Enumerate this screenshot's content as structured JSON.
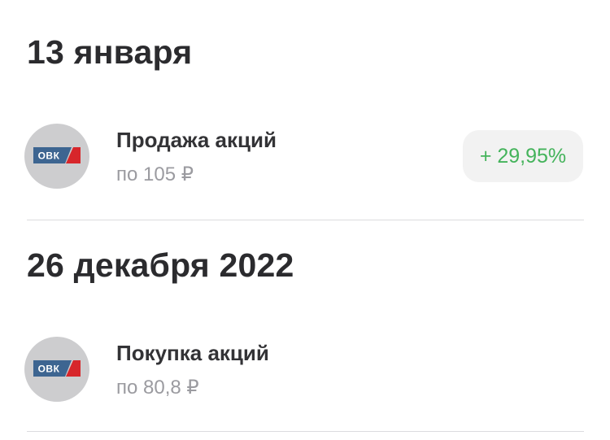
{
  "operations": [
    {
      "date": "13 января",
      "title": "Продажа акций",
      "price": "по 105 ₽",
      "change": "+ 29,95%",
      "change_color": "#44b35b",
      "logo": {
        "text": "ОВК",
        "icon": "ovk-logo-icon"
      }
    },
    {
      "date": "26 декабря 2022",
      "title": "Покупка акций",
      "price": "по 80,8 ₽",
      "logo": {
        "text": "ОВК",
        "icon": "ovk-logo-icon"
      }
    }
  ],
  "colors": {
    "logo_blue": "#3d6591",
    "logo_red": "#d7262b",
    "avatar_bg": "#cdcdcf"
  }
}
